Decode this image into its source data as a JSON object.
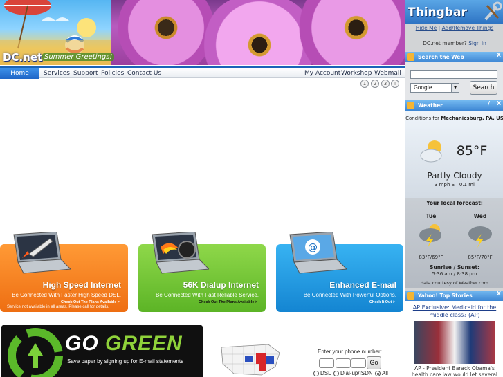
{
  "banner": {
    "logo": "DC.net",
    "greeting": "Summer Greetings!"
  },
  "nav": {
    "left": [
      "Home",
      "Services",
      "Support",
      "Policies",
      "Contact Us"
    ],
    "right": [
      "My Account",
      "Workshop",
      "Webmail"
    ]
  },
  "slider": {
    "dots": [
      "1",
      "2",
      "3",
      "II"
    ]
  },
  "promos": [
    {
      "title": "High Speed Internet",
      "tagline": "Be Connected With Faster High Speed DSL.",
      "link": "Check Out The Plans Available >",
      "note": "Service not available in all areas. Please call for details.",
      "color": "#f07a1a"
    },
    {
      "title": "56K Dialup Internet",
      "tagline": "Be Connected With Fast Reliable Service.",
      "link": "Check Out The Plans Available >",
      "color": "#6cc02c"
    },
    {
      "title": "Enhanced E-mail",
      "tagline": "Be Connected With Powerful Options.",
      "link": "Check It Out >",
      "color": "#1f9ae6"
    }
  ],
  "gogreen": {
    "word1": "GO",
    "word2": "GREEN",
    "subtitle": "Save paper by signing up for E-mail statements"
  },
  "lookup": {
    "label": "Enter your phone number:",
    "go": "Go",
    "options": [
      "DSL",
      "Dial-up/ISDN",
      "All"
    ],
    "selected": "All"
  },
  "thingbar": {
    "title": "Thingbar",
    "hide": "Hide Me",
    "add_remove": "Add/Remove Things",
    "member_prefix": "DC.net member?",
    "sign_in": "Sign in"
  },
  "search_panel": {
    "title": "Search the Web",
    "close": "X",
    "engine": "Google",
    "button": "Search"
  },
  "weather_panel": {
    "title": "Weather",
    "edit": "/",
    "close": "X",
    "conditions_prefix": "Conditions for",
    "location": "Mechanicsburg, PA, US",
    "temp": "85°F",
    "condition": "Partly Cloudy",
    "wind": "3 mph S | 0.1 mi",
    "forecast_label": "Your local forecast:",
    "days": [
      {
        "day": "Tue",
        "temps": "83°F/69°F"
      },
      {
        "day": "Wed",
        "temps": "85°F/70°F"
      }
    ],
    "sun_label": "Sunrise / Sunset:",
    "sun_times": "5:36 am / 8:38 pm",
    "credit": "data courtesy of Weather.com"
  },
  "news_panel": {
    "title": "Yahoo! Top Stories",
    "close": "X",
    "headline": "AP Exclusive: Medicaid for the middle class? (AP)",
    "caption": "AP - President Barack Obama's health care law would let several"
  }
}
